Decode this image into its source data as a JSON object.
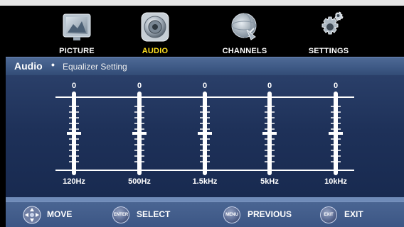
{
  "nav": {
    "items": [
      {
        "label": "PICTURE",
        "icon": "picture-icon",
        "active": false
      },
      {
        "label": "AUDIO",
        "icon": "speaker-icon",
        "active": true
      },
      {
        "label": "CHANNELS",
        "icon": "satellite-dish-icon",
        "active": false
      },
      {
        "label": "SETTINGS",
        "icon": "gears-icon",
        "active": false
      }
    ]
  },
  "header": {
    "title": "Audio",
    "separator": "•",
    "subtitle": "Equalizer Setting"
  },
  "equalizer": {
    "bands": [
      {
        "label": "120Hz",
        "value": "0"
      },
      {
        "label": "500Hz",
        "value": "0"
      },
      {
        "label": "1.5kHz",
        "value": "0"
      },
      {
        "label": "5kHz",
        "value": "0"
      },
      {
        "label": "10kHz",
        "value": "0"
      }
    ]
  },
  "footer": {
    "items": [
      {
        "button": "",
        "label": "MOVE",
        "icon": "dpad-icon"
      },
      {
        "button": "ENTER",
        "label": "SELECT",
        "icon": "enter-button-icon"
      },
      {
        "button": "MENU",
        "label": "PREVIOUS",
        "icon": "menu-button-icon"
      },
      {
        "button": "EXIT",
        "label": "EXIT",
        "icon": "exit-button-icon"
      }
    ]
  },
  "colors": {
    "active_label": "#ffe020",
    "header_bar": "#3d5884",
    "panel": "#1e3159"
  }
}
